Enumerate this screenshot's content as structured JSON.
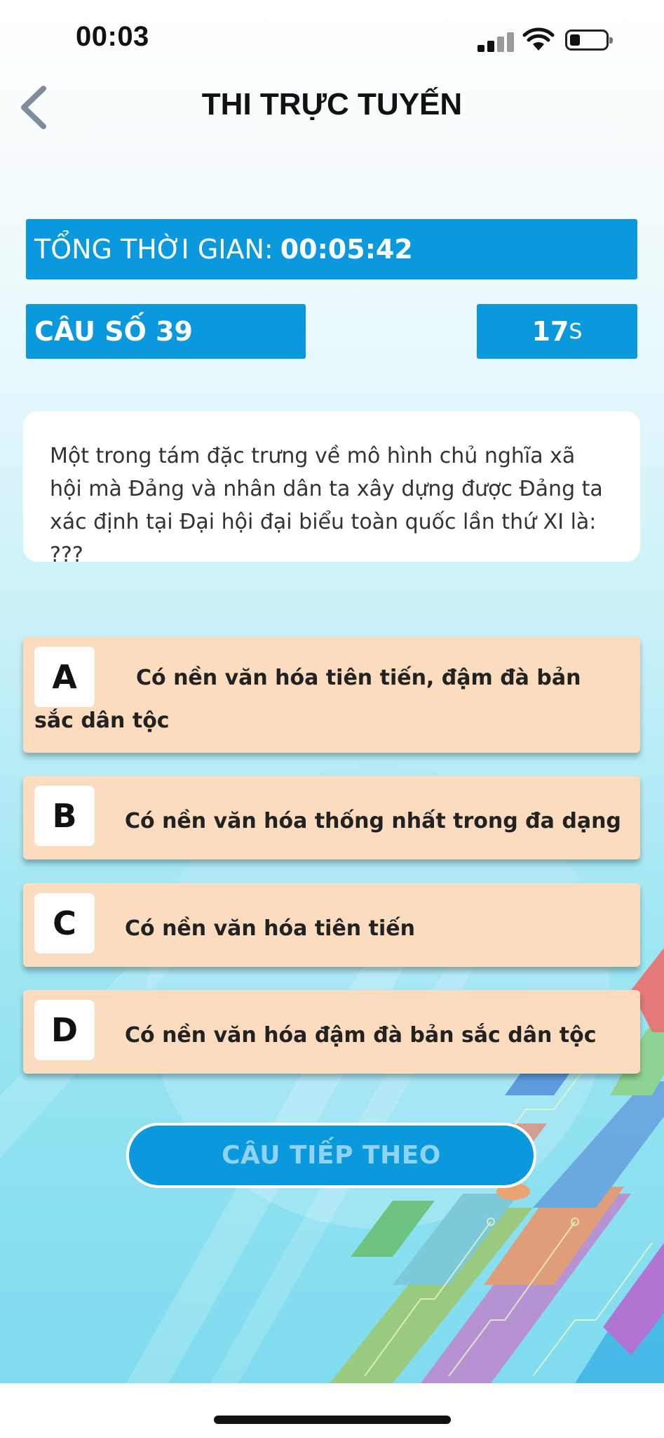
{
  "status_bar": {
    "time": "00:03"
  },
  "header": {
    "title": "THI TRỰC TUYẾN"
  },
  "total_time": {
    "label": "TỔNG THỜI GIAN:",
    "value": "00:05:42"
  },
  "question_number": "CÂU SỐ 39",
  "countdown": {
    "value": "17",
    "unit": "S"
  },
  "question_text": "Một trong tám đặc trưng về mô hình chủ nghĩa xã hội mà Đảng và nhân dân ta xây dựng được Đảng ta xác định tại Đại hội đại biểu toàn quốc lần thứ XI là: ???",
  "options": [
    {
      "letter": "A",
      "text": "Có nền văn hóa tiên tiến, đậm đà bản sắc dân tộc"
    },
    {
      "letter": "B",
      "text": "Có nền văn hóa thống nhất trong đa dạng"
    },
    {
      "letter": "C",
      "text": "Có nền văn hóa tiên tiến"
    },
    {
      "letter": "D",
      "text": "Có nền văn hóa đậm đà bản sắc dân tộc"
    }
  ],
  "next_button": "CÂU TIẾP THEO",
  "colors": {
    "accent": "#0a99dc",
    "option_bg": "#fbdcbe"
  },
  "icons": {
    "back": "chevron-left-icon",
    "signal": "cellular-signal-icon",
    "wifi": "wifi-icon",
    "battery": "battery-icon"
  }
}
